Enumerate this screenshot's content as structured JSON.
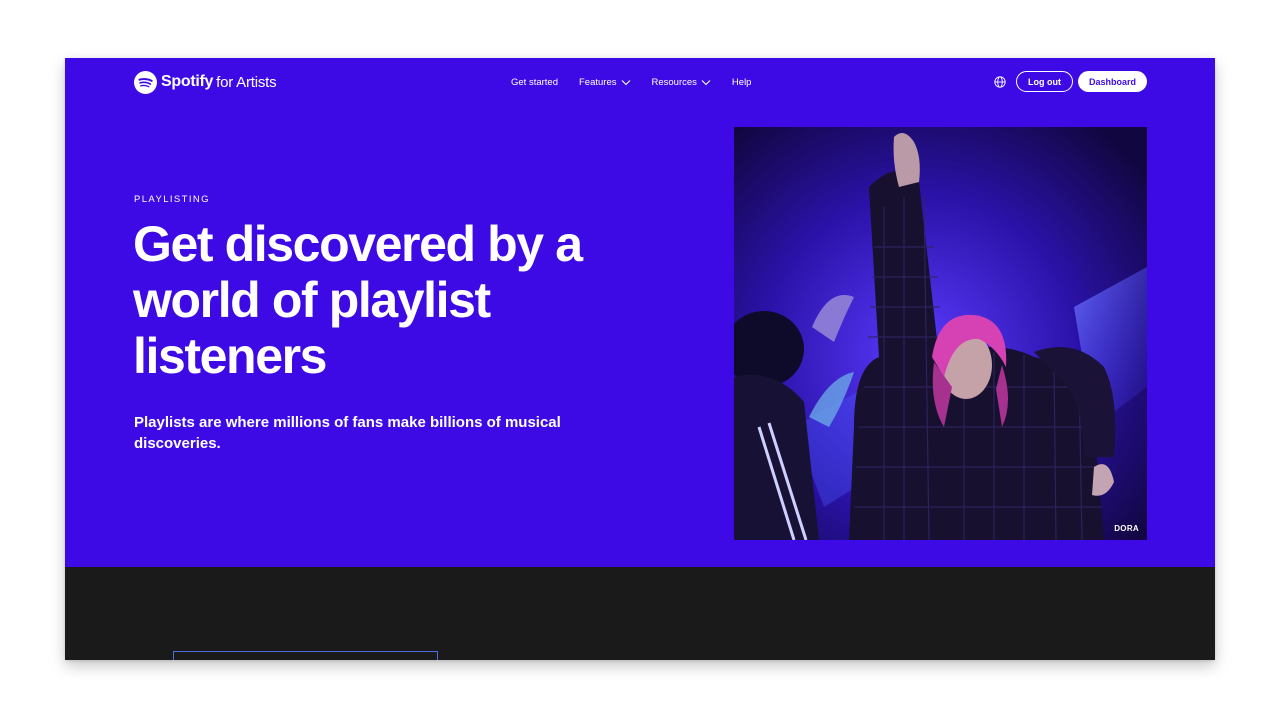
{
  "brand": {
    "name": "Spotify",
    "sub": "for Artists",
    "icon": "spotify-logo-icon"
  },
  "nav": {
    "items": [
      {
        "label": "Get started",
        "has_dropdown": false
      },
      {
        "label": "Features",
        "has_dropdown": true
      },
      {
        "label": "Resources",
        "has_dropdown": true
      },
      {
        "label": "Help",
        "has_dropdown": false
      }
    ]
  },
  "actions": {
    "language_icon": "globe-icon",
    "logout_label": "Log out",
    "dashboard_label": "Dashboard"
  },
  "hero": {
    "eyebrow": "PLAYLISTING",
    "headline": "Get discovered by a world of playlist listeners",
    "subtext": "Playlists are where millions of fans make billions of musical discoveries.",
    "image_caption": "DORA"
  },
  "colors": {
    "hero_bg": "#3d0ae6",
    "dark_section": "#1a1a1a",
    "text": "#ffffff",
    "card_outline": "#4b6fd8"
  }
}
